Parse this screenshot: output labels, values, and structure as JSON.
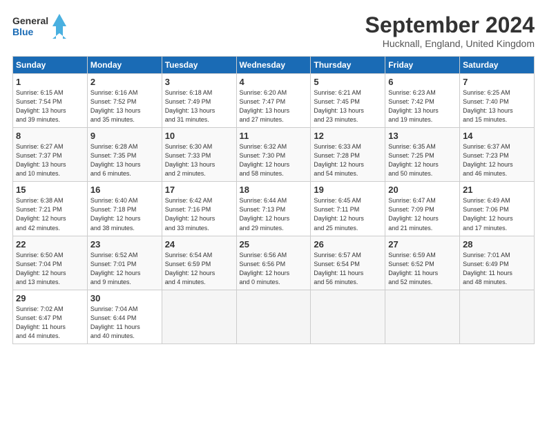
{
  "header": {
    "logo_line1": "General",
    "logo_line2": "Blue",
    "month_title": "September 2024",
    "location": "Hucknall, England, United Kingdom"
  },
  "columns": [
    "Sunday",
    "Monday",
    "Tuesday",
    "Wednesday",
    "Thursday",
    "Friday",
    "Saturday"
  ],
  "weeks": [
    [
      {
        "day": "1",
        "info": "Sunrise: 6:15 AM\nSunset: 7:54 PM\nDaylight: 13 hours\nand 39 minutes."
      },
      {
        "day": "2",
        "info": "Sunrise: 6:16 AM\nSunset: 7:52 PM\nDaylight: 13 hours\nand 35 minutes."
      },
      {
        "day": "3",
        "info": "Sunrise: 6:18 AM\nSunset: 7:49 PM\nDaylight: 13 hours\nand 31 minutes."
      },
      {
        "day": "4",
        "info": "Sunrise: 6:20 AM\nSunset: 7:47 PM\nDaylight: 13 hours\nand 27 minutes."
      },
      {
        "day": "5",
        "info": "Sunrise: 6:21 AM\nSunset: 7:45 PM\nDaylight: 13 hours\nand 23 minutes."
      },
      {
        "day": "6",
        "info": "Sunrise: 6:23 AM\nSunset: 7:42 PM\nDaylight: 13 hours\nand 19 minutes."
      },
      {
        "day": "7",
        "info": "Sunrise: 6:25 AM\nSunset: 7:40 PM\nDaylight: 13 hours\nand 15 minutes."
      }
    ],
    [
      {
        "day": "8",
        "info": "Sunrise: 6:27 AM\nSunset: 7:37 PM\nDaylight: 13 hours\nand 10 minutes."
      },
      {
        "day": "9",
        "info": "Sunrise: 6:28 AM\nSunset: 7:35 PM\nDaylight: 13 hours\nand 6 minutes."
      },
      {
        "day": "10",
        "info": "Sunrise: 6:30 AM\nSunset: 7:33 PM\nDaylight: 13 hours\nand 2 minutes."
      },
      {
        "day": "11",
        "info": "Sunrise: 6:32 AM\nSunset: 7:30 PM\nDaylight: 12 hours\nand 58 minutes."
      },
      {
        "day": "12",
        "info": "Sunrise: 6:33 AM\nSunset: 7:28 PM\nDaylight: 12 hours\nand 54 minutes."
      },
      {
        "day": "13",
        "info": "Sunrise: 6:35 AM\nSunset: 7:25 PM\nDaylight: 12 hours\nand 50 minutes."
      },
      {
        "day": "14",
        "info": "Sunrise: 6:37 AM\nSunset: 7:23 PM\nDaylight: 12 hours\nand 46 minutes."
      }
    ],
    [
      {
        "day": "15",
        "info": "Sunrise: 6:38 AM\nSunset: 7:21 PM\nDaylight: 12 hours\nand 42 minutes."
      },
      {
        "day": "16",
        "info": "Sunrise: 6:40 AM\nSunset: 7:18 PM\nDaylight: 12 hours\nand 38 minutes."
      },
      {
        "day": "17",
        "info": "Sunrise: 6:42 AM\nSunset: 7:16 PM\nDaylight: 12 hours\nand 33 minutes."
      },
      {
        "day": "18",
        "info": "Sunrise: 6:44 AM\nSunset: 7:13 PM\nDaylight: 12 hours\nand 29 minutes."
      },
      {
        "day": "19",
        "info": "Sunrise: 6:45 AM\nSunset: 7:11 PM\nDaylight: 12 hours\nand 25 minutes."
      },
      {
        "day": "20",
        "info": "Sunrise: 6:47 AM\nSunset: 7:09 PM\nDaylight: 12 hours\nand 21 minutes."
      },
      {
        "day": "21",
        "info": "Sunrise: 6:49 AM\nSunset: 7:06 PM\nDaylight: 12 hours\nand 17 minutes."
      }
    ],
    [
      {
        "day": "22",
        "info": "Sunrise: 6:50 AM\nSunset: 7:04 PM\nDaylight: 12 hours\nand 13 minutes."
      },
      {
        "day": "23",
        "info": "Sunrise: 6:52 AM\nSunset: 7:01 PM\nDaylight: 12 hours\nand 9 minutes."
      },
      {
        "day": "24",
        "info": "Sunrise: 6:54 AM\nSunset: 6:59 PM\nDaylight: 12 hours\nand 4 minutes."
      },
      {
        "day": "25",
        "info": "Sunrise: 6:56 AM\nSunset: 6:56 PM\nDaylight: 12 hours\nand 0 minutes."
      },
      {
        "day": "26",
        "info": "Sunrise: 6:57 AM\nSunset: 6:54 PM\nDaylight: 11 hours\nand 56 minutes."
      },
      {
        "day": "27",
        "info": "Sunrise: 6:59 AM\nSunset: 6:52 PM\nDaylight: 11 hours\nand 52 minutes."
      },
      {
        "day": "28",
        "info": "Sunrise: 7:01 AM\nSunset: 6:49 PM\nDaylight: 11 hours\nand 48 minutes."
      }
    ],
    [
      {
        "day": "29",
        "info": "Sunrise: 7:02 AM\nSunset: 6:47 PM\nDaylight: 11 hours\nand 44 minutes."
      },
      {
        "day": "30",
        "info": "Sunrise: 7:04 AM\nSunset: 6:44 PM\nDaylight: 11 hours\nand 40 minutes."
      },
      null,
      null,
      null,
      null,
      null
    ]
  ]
}
